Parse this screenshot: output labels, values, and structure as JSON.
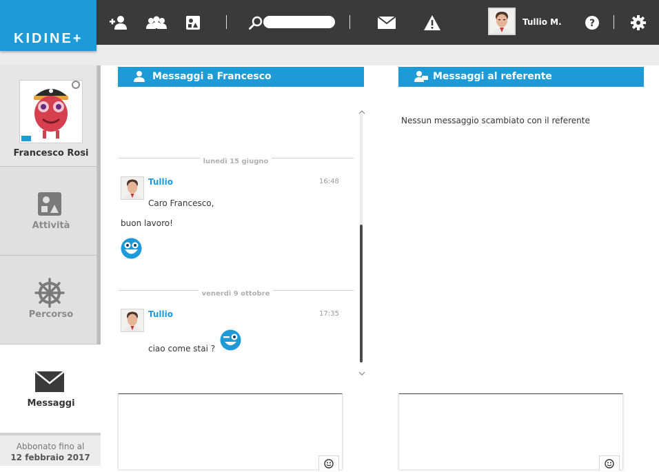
{
  "app": {
    "logo": "KIDINE+"
  },
  "topbar": {
    "search_placeholder": "",
    "user_name": "Tullio M.",
    "icons": [
      "add-user-icon",
      "group-icon",
      "activities-icon",
      "search-icon",
      "mail-icon",
      "warning-icon",
      "help-icon",
      "gear-icon"
    ]
  },
  "sidebar": {
    "profile_name": "Francesco Rosi",
    "items": [
      {
        "label": "Attività",
        "icon": "activities-icon"
      },
      {
        "label": "Percorso",
        "icon": "helm-icon"
      },
      {
        "label": "Messaggi",
        "icon": "mail-icon",
        "active": true
      }
    ],
    "subscription_line1": "Abbonato fino al",
    "subscription_line2": "12 febbraio 2017"
  },
  "left_panel": {
    "title": "Messaggi a Francesco",
    "groups": [
      {
        "date": "lunedì 15 giugno",
        "author": "Tullio",
        "time": "16:48",
        "line1": "Caro Francesco,",
        "line2": "buon lavoro!"
      },
      {
        "date": "venerdì 9 ottobre",
        "author": "Tullio",
        "time": "17:35",
        "line1": "ciao come stai ?"
      }
    ],
    "compose_placeholder": ""
  },
  "right_panel": {
    "title": "Messaggi al referente",
    "empty_text": "Nessun messaggio scambiato con il referente",
    "compose_placeholder": ""
  },
  "colors": {
    "brand": "#1e9ad6",
    "topbar": "#3a3a3c"
  }
}
